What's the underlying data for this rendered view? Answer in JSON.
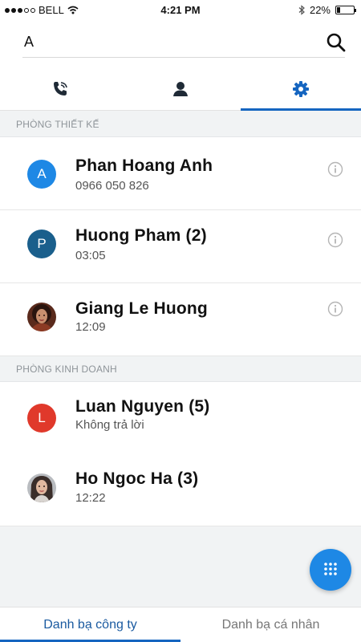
{
  "status_bar": {
    "carrier": "BELL",
    "time": "4:21 PM",
    "battery": "22%",
    "battery_level": 0.22
  },
  "search": {
    "query": "A"
  },
  "tabs": [
    {
      "icon": "phone-call-icon",
      "active": false
    },
    {
      "icon": "person-icon",
      "active": false
    },
    {
      "icon": "gear-icon",
      "active": true
    }
  ],
  "sections": [
    {
      "title": "PHÒNG THIẾT KẾ",
      "contacts": [
        {
          "name": "Phan Hoang Anh",
          "sub": "0966 050 826",
          "avatar_letter": "A",
          "avatar_color": "#1e88e5",
          "has_info": true
        },
        {
          "name": "Huong Pham (2)",
          "sub": "03:05",
          "avatar_letter": "P",
          "avatar_color": "#1a5f8c",
          "has_info": true
        },
        {
          "name": "Giang Le Huong",
          "sub": "12:09",
          "avatar_photo": true,
          "has_info": true
        }
      ]
    },
    {
      "title": "PHÒNG KINH DOANH",
      "contacts": [
        {
          "name": "Luan Nguyen (5)",
          "sub": "Không trả lời",
          "avatar_letter": "L",
          "avatar_color": "#e0392b",
          "has_info": false
        },
        {
          "name": "Ho Ngoc Ha (3)",
          "sub": "12:22",
          "avatar_photo": true,
          "has_info": false
        }
      ]
    }
  ],
  "fab": {
    "icon": "dialpad-icon"
  },
  "bottom_nav": [
    {
      "label": "Danh bạ công ty",
      "active": true
    },
    {
      "label": "Danh bạ cá nhân",
      "active": false
    }
  ],
  "colors": {
    "accent": "#1565c0",
    "fab": "#1e88e5"
  }
}
